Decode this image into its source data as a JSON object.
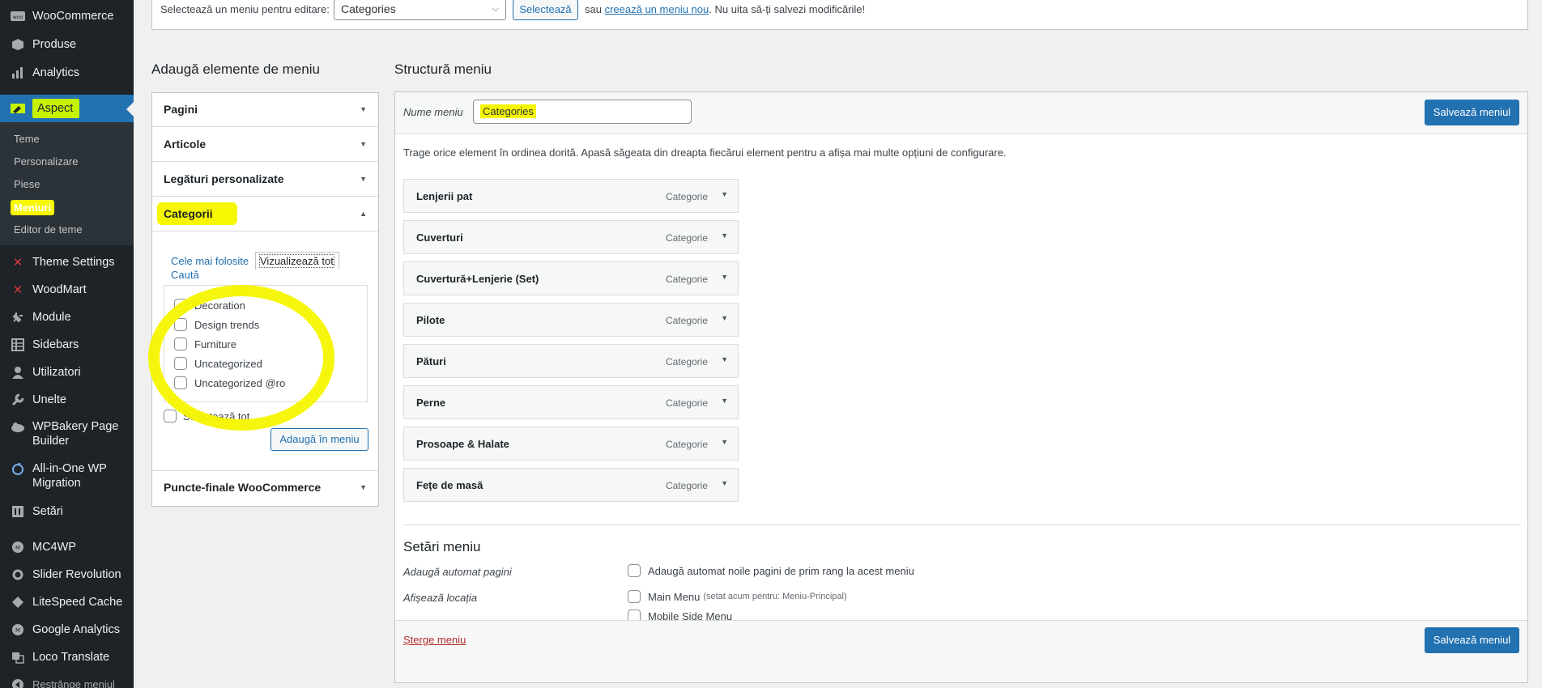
{
  "sidebar": {
    "items": [
      {
        "label": "WooCommerce",
        "icon": "woocommerce-icon"
      },
      {
        "label": "Produse",
        "icon": "box-icon"
      },
      {
        "label": "Analytics",
        "icon": "bar-chart-icon"
      },
      {
        "label": "Aspect",
        "icon": "paint-brush-icon"
      },
      {
        "label": "Theme Settings",
        "icon": "theme-settings-icon"
      },
      {
        "label": "WoodMart",
        "icon": "woodmart-icon"
      },
      {
        "label": "Module",
        "icon": "plug-icon"
      },
      {
        "label": "Sidebars",
        "icon": "sidebars-icon"
      },
      {
        "label": "Utilizatori",
        "icon": "user-icon"
      },
      {
        "label": "Unelte",
        "icon": "wrench-icon"
      },
      {
        "label": "WPBakery Page Builder",
        "icon": "wpbakery-icon"
      },
      {
        "label": "All-in-One WP Migration",
        "icon": "migration-icon"
      },
      {
        "label": "Setări",
        "icon": "settings-icon"
      },
      {
        "label": "MC4WP",
        "icon": "mc4wp-icon"
      },
      {
        "label": "Slider Revolution",
        "icon": "slider-icon"
      },
      {
        "label": "LiteSpeed Cache",
        "icon": "litespeed-icon"
      },
      {
        "label": "Google Analytics",
        "icon": "analytics-icon"
      },
      {
        "label": "Loco Translate",
        "icon": "translate-icon"
      },
      {
        "label": "Restrânge meniul",
        "icon": "collapse-icon"
      }
    ],
    "submenu": [
      "Teme",
      "Personalizare",
      "Piese",
      "Meniuri",
      "Editor de teme"
    ]
  },
  "manage": {
    "label": "Selectează un meniu pentru editare:",
    "select_value": "Categories",
    "select_button": "Selectează",
    "hint_prefix": "sau",
    "hint_link": "creează un meniu nou",
    "hint_suffix": ". Nu uita să-ți salvezi modificările!"
  },
  "add_items": {
    "title": "Adaugă elemente de meniu",
    "sections": [
      "Pagini",
      "Articole",
      "Legături personalizate",
      "Categorii",
      "Puncte-finale WooCommerce"
    ],
    "tabs": {
      "most_used": "Cele mai folosite",
      "view_all": "Vizualizează tot",
      "search": "Caută"
    },
    "categories": [
      "Decoration",
      "Design trends",
      "Furniture",
      "Uncategorized",
      "Uncategorized @ro"
    ],
    "select_all": "Selectează tot",
    "add_button": "Adaugă în meniu"
  },
  "structure": {
    "title": "Structură meniu",
    "name_label": "Nume meniu",
    "name_value": "Categories",
    "save_label": "Salvează meniul",
    "hint": "Trage orice element în ordinea dorită. Apasă săgeata din dreapta fiecărui element pentru a afișa mai multe opțiuni de configurare.",
    "items": [
      {
        "title": "Lenjerii pat",
        "type": "Categorie"
      },
      {
        "title": "Cuverturi",
        "type": "Categorie"
      },
      {
        "title": "Cuvertură+Lenjerie (Set)",
        "type": "Categorie"
      },
      {
        "title": "Pilote",
        "type": "Categorie"
      },
      {
        "title": "Pături",
        "type": "Categorie"
      },
      {
        "title": "Perne",
        "type": "Categorie"
      },
      {
        "title": "Prosoape & Halate",
        "type": "Categorie"
      },
      {
        "title": "Fețe de masă",
        "type": "Categorie"
      }
    ],
    "settings": {
      "title": "Setări meniu",
      "auto_add_label": "Adaugă automat pagini",
      "auto_add_option": "Adaugă automat noile pagini de prim rang la acest meniu",
      "locations_label": "Afișează locația",
      "main_menu": "Main Menu",
      "main_menu_note": "(setat acum pentru: Meniu-Principal)",
      "mobile_menu": "Mobile Side Menu"
    },
    "delete_label": "Șterge meniu"
  },
  "colors": {
    "accent": "#2271b1",
    "sidebar": "#1d2327",
    "highlight": "#f7f700",
    "delete": "#b32d2e"
  }
}
